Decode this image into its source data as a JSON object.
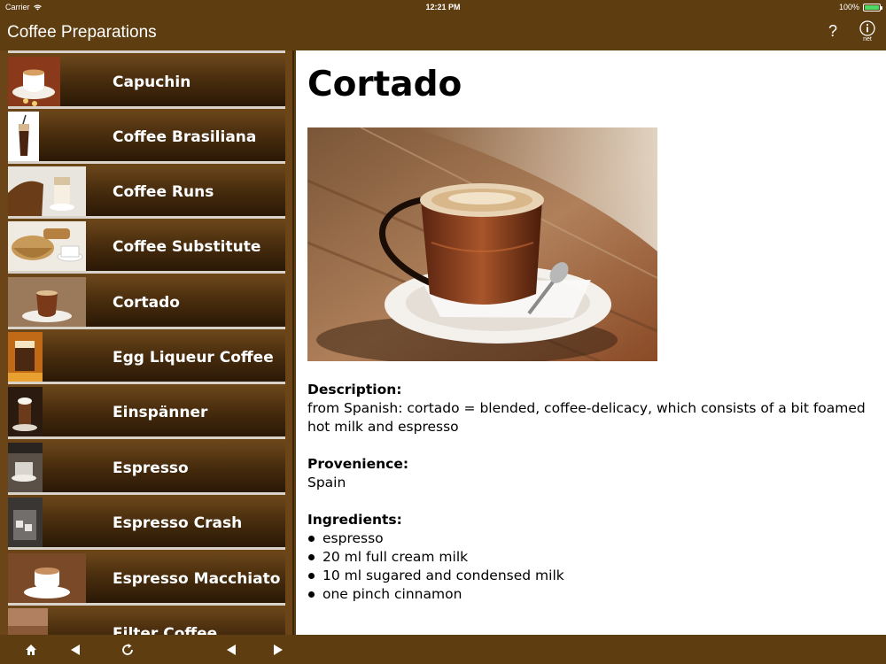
{
  "status_bar": {
    "carrier": "Carrier",
    "time": "12:21 PM",
    "battery": "100%"
  },
  "navbar": {
    "title": "Coffee Preparations",
    "help_label": "?",
    "info_label": "net"
  },
  "list": {
    "items": [
      {
        "label": "Capuchin"
      },
      {
        "label": "Coffee Brasiliana"
      },
      {
        "label": "Coffee Runs"
      },
      {
        "label": "Coffee Substitute"
      },
      {
        "label": "Cortado"
      },
      {
        "label": "Egg Liqueur Coffee"
      },
      {
        "label": "Einspänner"
      },
      {
        "label": "Espresso"
      },
      {
        "label": "Espresso Crash"
      },
      {
        "label": "Espresso Macchiato"
      },
      {
        "label": "Filter Coffee"
      }
    ]
  },
  "detail": {
    "title": "Cortado",
    "description_heading": "Description:",
    "description": "from Spanish: cortado = blended, coffee-delicacy, which consists of a bit foamed hot milk and espresso",
    "provenience_heading": "Provenience:",
    "provenience": "Spain",
    "ingredients_heading": "Ingredients:",
    "ingredients": [
      "espresso",
      "20 ml full cream milk",
      "10 ml sugared and condensed milk",
      "one pinch cinnamon"
    ]
  },
  "icons": {
    "home": "home-icon",
    "back": "arrow-left-icon",
    "reload": "reload-icon",
    "prev": "arrow-left-icon",
    "next": "arrow-right-icon",
    "info": "info-icon",
    "help": "question-icon"
  },
  "colors": {
    "brand_brown": "#5e3d10",
    "list_background": "#6b4517",
    "battery_green": "#4cd964"
  }
}
